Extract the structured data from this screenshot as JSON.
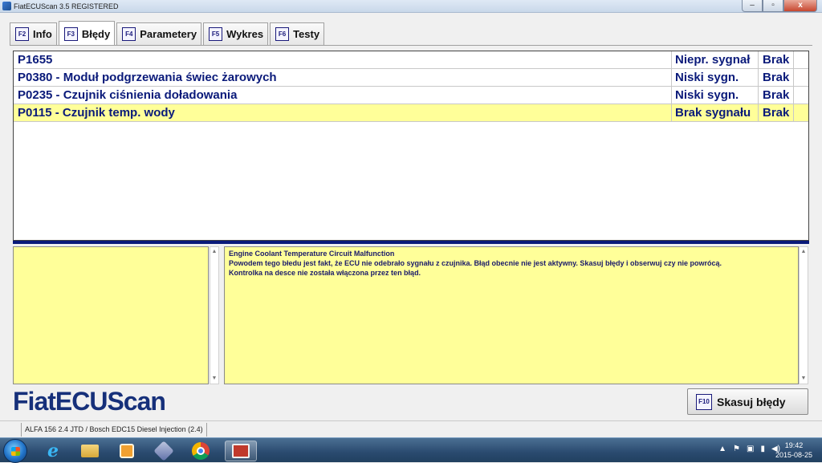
{
  "window": {
    "title": "FiatECUScan 3.5 REGISTERED",
    "buttons": {
      "minimize": "–",
      "maximize": "▫",
      "close": "x"
    }
  },
  "tabs": [
    {
      "key": "F2",
      "label": "Info"
    },
    {
      "key": "F3",
      "label": "Błędy",
      "active": true
    },
    {
      "key": "F4",
      "label": "Parametery"
    },
    {
      "key": "F5",
      "label": "Wykres"
    },
    {
      "key": "F6",
      "label": "Testy"
    }
  ],
  "errors": [
    {
      "code": "P1655",
      "signal": "Niepr. sygnał",
      "status": "Brak"
    },
    {
      "code": "P0380 - Moduł podgrzewania świec żarowych",
      "signal": "Niski sygn.",
      "status": "Brak"
    },
    {
      "code": "P0235 - Czujnik ciśnienia doładowania",
      "signal": "Niski sygn.",
      "status": "Brak"
    },
    {
      "code": "P0115 - Czujnik temp. wody",
      "signal": "Brak sygnału",
      "status": "Brak",
      "selected": true
    }
  ],
  "description": {
    "title": "Engine Coolant Temperature Circuit Malfunction",
    "line1": "Powodem tego błedu jest fakt, że ECU nie odebrało sygnału z czujnika. Błąd obecnie nie jest aktywny. Skasuj błędy i obserwuj czy nie powrócą.",
    "line2": "Kontrolka na desce nie została włączona przez ten błąd."
  },
  "logo": "FiatECUScan",
  "clear_button": {
    "key": "F10",
    "label": "Skasuj błędy"
  },
  "statusbar": {
    "vehicle": "ALFA 156 2.4 JTD / Bosch EDC15 Diesel Injection (2.4)"
  },
  "taskbar": {
    "time": "19:42",
    "date": "2015-08-25"
  },
  "colors": {
    "selected_row": "#ffff99",
    "text_blue": "#0a1a7a",
    "panel_yellow": "#ffff99"
  }
}
